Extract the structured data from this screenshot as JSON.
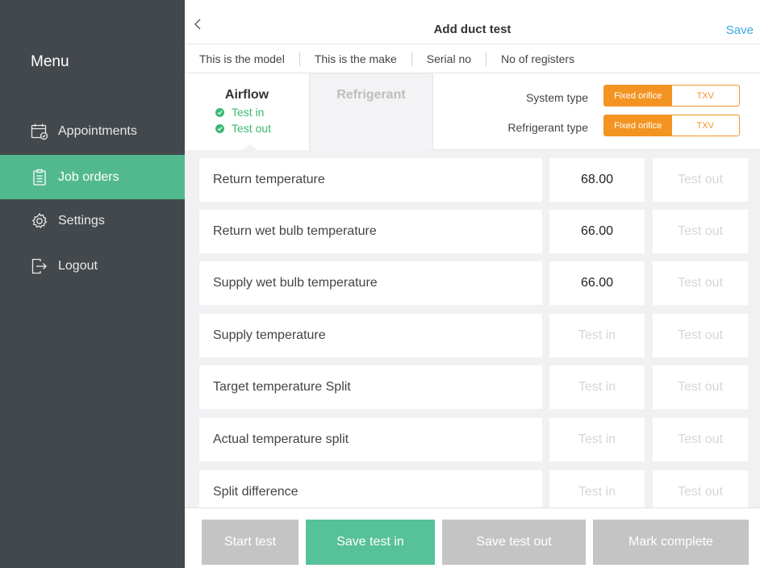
{
  "sidebar": {
    "title": "Menu",
    "items": [
      {
        "label": "Appointments",
        "icon": "calendar-icon"
      },
      {
        "label": "Job orders",
        "icon": "clipboard-icon",
        "active": true
      },
      {
        "label": "Settings",
        "icon": "gear-icon"
      },
      {
        "label": "Logout",
        "icon": "logout-icon"
      }
    ]
  },
  "header": {
    "title": "Add duct test",
    "save_label": "Save"
  },
  "info": {
    "model": "This is the model",
    "make": "This is  the make",
    "serial": "Serial no",
    "registers": "No of registers"
  },
  "tabs": {
    "airflow": {
      "label": "Airflow",
      "status": [
        "Test in",
        "Test out"
      ]
    },
    "refrigerant": {
      "label": "Refrigerant"
    }
  },
  "system": {
    "system_type_label": "System type",
    "refrigerant_type_label": "Refrigerant type",
    "option_fixed": "Fixed orifice",
    "option_txv": "TXV",
    "system_type_selected": "Fixed orifice",
    "refrigerant_type_selected": "Fixed orifice"
  },
  "colors": {
    "sidebar": "#43484d",
    "accent_green": "#52b98f",
    "accent_orange": "#f39422",
    "link_blue": "#3aa8e0"
  },
  "placeholders": {
    "test_in": "Test in",
    "test_out": "Test out"
  },
  "rows": [
    {
      "label": "Return temperature",
      "test_in": "68.00",
      "test_out": ""
    },
    {
      "label": "Return wet bulb temperature",
      "test_in": "66.00",
      "test_out": ""
    },
    {
      "label": "Supply wet bulb temperature",
      "test_in": "66.00",
      "test_out": ""
    },
    {
      "label": "Supply temperature",
      "test_in": "",
      "test_out": ""
    },
    {
      "label": "Target temperature Split",
      "test_in": "",
      "test_out": ""
    },
    {
      "label": "Actual temperature split",
      "test_in": "",
      "test_out": ""
    },
    {
      "label": "Split difference",
      "test_in": "",
      "test_out": ""
    }
  ],
  "actions": {
    "start_test": "Start test",
    "save_test_in": "Save test in",
    "save_test_out": "Save test out",
    "mark_complete": "Mark complete"
  }
}
